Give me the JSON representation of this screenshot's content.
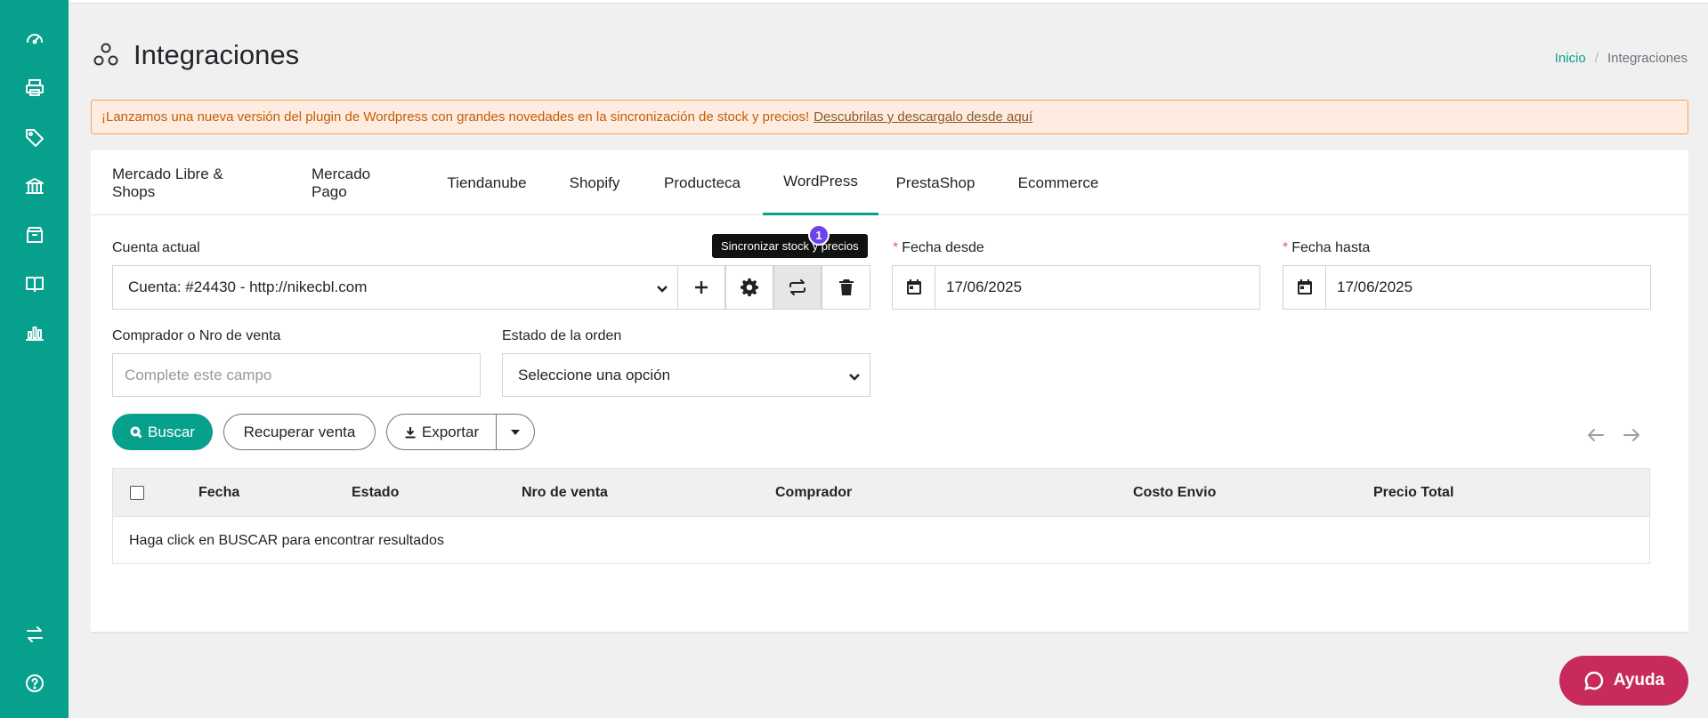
{
  "page": {
    "title": "Integraciones",
    "breadcrumb": {
      "home": "Inicio",
      "current": "Integraciones",
      "separator": "/"
    }
  },
  "sidebar": {
    "icons": [
      "dashboard-icon",
      "printer-icon",
      "tag-icon",
      "bank-icon",
      "box-icon",
      "book-icon",
      "bar-chart-icon",
      "transfer-icon",
      "help-circle-icon"
    ]
  },
  "alert": {
    "text": "¡Lanzamos una nueva versión del plugin de Wordpress con grandes novedades en la sincronización de stock y precios!",
    "link": "Descubrilas y descargalo desde aquí"
  },
  "tabs": [
    {
      "label": "Mercado Libre & Shops"
    },
    {
      "label": "Mercado Pago"
    },
    {
      "label": "Tiendanube"
    },
    {
      "label": "Shopify"
    },
    {
      "label": "Producteca"
    },
    {
      "label": "WordPress",
      "active": true
    },
    {
      "label": "PrestaShop"
    },
    {
      "label": "Ecommerce"
    }
  ],
  "form": {
    "account_label": "Cuenta actual",
    "account_value": "Cuenta: #24430 - http://nikecbl.com",
    "tooltip": "Sincronizar stock y precios",
    "badge": "1",
    "date_from_label": "Fecha desde",
    "date_from_value": "17/06/2025",
    "date_to_label": "Fecha hasta",
    "date_to_value": "17/06/2025",
    "required_mark": "*",
    "buyer_label": "Comprador o Nro de venta",
    "buyer_placeholder": "Complete este campo",
    "status_label": "Estado de la orden",
    "status_value": "Seleccione una opción"
  },
  "actions": {
    "search": "Buscar",
    "recover": "Recuperar venta",
    "export": "Exportar"
  },
  "table": {
    "columns": [
      "Fecha",
      "Estado",
      "Nro de venta",
      "Comprador",
      "Costo Envio",
      "Precio Total"
    ],
    "empty_message": "Haga click en BUSCAR para encontrar resultados"
  },
  "help_button": {
    "label": "Ayuda"
  },
  "colors": {
    "accent": "#07a08c",
    "help": "#c62b5b",
    "alert_bg": "#fdecdf",
    "badge": "#6f42f0"
  }
}
